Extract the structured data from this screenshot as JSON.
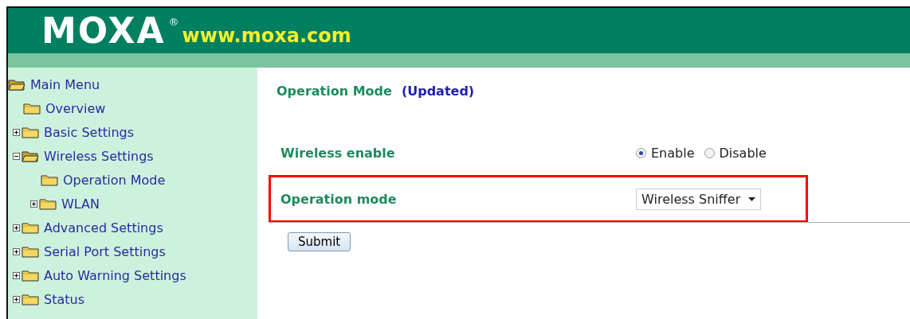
{
  "header": {
    "logo": "MOXA",
    "registered": "®",
    "url": "www.moxa.com"
  },
  "sidebar": {
    "root": "Main Menu",
    "tree": [
      {
        "label": "Overview"
      },
      {
        "label": "Basic Settings",
        "expanded": false
      },
      {
        "label": "Wireless Settings",
        "expanded": true,
        "children": [
          {
            "label": "Operation Mode"
          },
          {
            "label": "WLAN",
            "expanded": false
          }
        ]
      },
      {
        "label": "Advanced Settings",
        "expanded": false
      },
      {
        "label": "Serial Port Settings",
        "expanded": false
      },
      {
        "label": "Auto Warning Settings",
        "expanded": false
      },
      {
        "label": "Status",
        "expanded": false
      }
    ]
  },
  "content": {
    "title": "Operation Mode",
    "title_note": "(Updated)",
    "rows": [
      {
        "kind": "radio",
        "label": "Wireless enable",
        "highlighted": false,
        "options": [
          {
            "label": "Enable",
            "selected": true
          },
          {
            "label": "Disable",
            "selected": false
          }
        ]
      },
      {
        "kind": "select",
        "label": "Operation mode",
        "highlighted": true,
        "value": "Wireless Sniffer"
      }
    ],
    "submit": "Submit"
  }
}
